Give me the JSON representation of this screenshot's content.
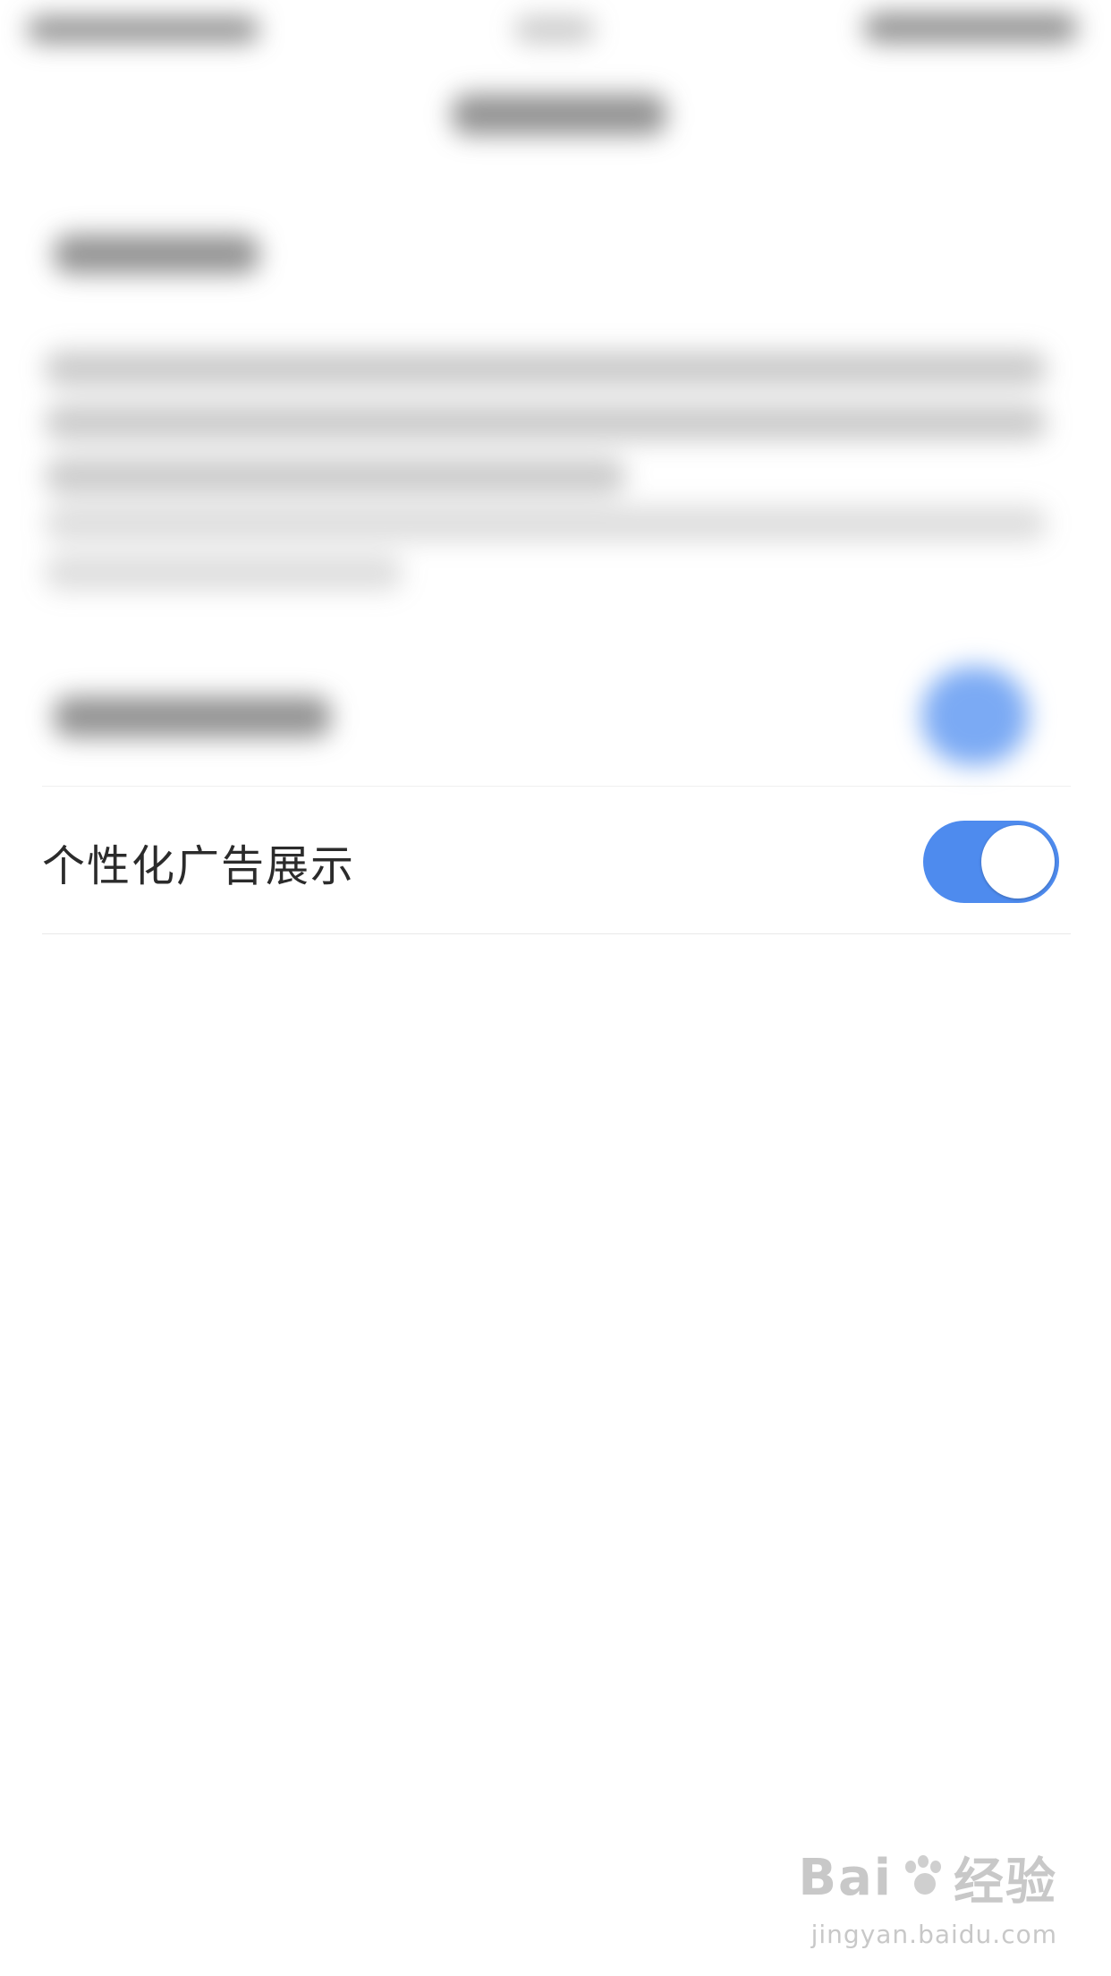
{
  "setting": {
    "label": "个性化广告展示",
    "enabled": true
  },
  "colors": {
    "toggle_on": "#4e8bee",
    "text": "#2b2b2b",
    "divider": "#e8e8e8"
  },
  "watermark": {
    "logo_left": "Bai",
    "logo_right": "经验",
    "url": "jingyan.baidu.com"
  }
}
